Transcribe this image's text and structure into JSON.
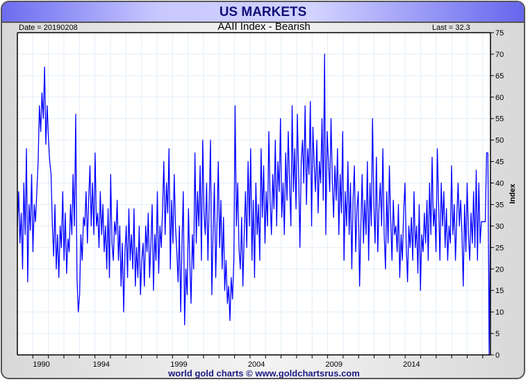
{
  "header": {
    "title": "US MARKETS"
  },
  "info": {
    "date": "Date = 20190208",
    "last": "Last = 32.3"
  },
  "footer": "world gold charts © www.goldchartsrus.com",
  "colors": {
    "line": "#0000ff",
    "grid": "#e2eef8"
  },
  "chart_data": {
    "type": "line",
    "title": "AAII Index - Bearish",
    "ylabel": "Index",
    "xlabel": "",
    "ylim": [
      0,
      75
    ],
    "xlim": [
      1988.6,
      2019.1
    ],
    "yticks": [
      0,
      5,
      10,
      15,
      20,
      25,
      30,
      35,
      40,
      45,
      50,
      55,
      60,
      65,
      70,
      75
    ],
    "xticks": [
      {
        "label": "1990",
        "year": 1989.6
      },
      {
        "label": "1994",
        "year": 1994
      },
      {
        "label": "1999",
        "year": 1999
      },
      {
        "label": "2004",
        "year": 2004
      },
      {
        "label": "2009",
        "year": 2009
      },
      {
        "label": "2014",
        "year": 2014
      }
    ],
    "grid": true,
    "series": [
      {
        "name": "AAII Bearish",
        "start": 1988.6,
        "end": 2019.1,
        "values": [
          30,
          38,
          26,
          33,
          20,
          40,
          28,
          48,
          17,
          35,
          29,
          42,
          24,
          35,
          31,
          38,
          45,
          58,
          52,
          61,
          55,
          67,
          49,
          58,
          50,
          45,
          42,
          30,
          23,
          35,
          20,
          28,
          18,
          30,
          25,
          38,
          22,
          33,
          19,
          27,
          24,
          35,
          28,
          42,
          30,
          56,
          18,
          10,
          14,
          28,
          22,
          32,
          30,
          38,
          26,
          36,
          44,
          30,
          40,
          28,
          47,
          30,
          33,
          25,
          38,
          28,
          35,
          24,
          30,
          20,
          34,
          18,
          42,
          26,
          22,
          31,
          28,
          36,
          22,
          30,
          16,
          26,
          10,
          24,
          30,
          18,
          34,
          22,
          28,
          20,
          34,
          16,
          25,
          18,
          30,
          14,
          22,
          26,
          16,
          30,
          24,
          33,
          18,
          26,
          35,
          15,
          28,
          22,
          38,
          19,
          30,
          25,
          34,
          45,
          28,
          40,
          33,
          48,
          20,
          36,
          26,
          42,
          30,
          24,
          17,
          30,
          10,
          26,
          38,
          7,
          20,
          14,
          34,
          22,
          12,
          28,
          20,
          47,
          26,
          38,
          30,
          44,
          22,
          50,
          33,
          28,
          40,
          22,
          35,
          50,
          14,
          28,
          40,
          18,
          30,
          45,
          25,
          36,
          20,
          32,
          15,
          22,
          12,
          16,
          8,
          18,
          13,
          22,
          58,
          30,
          40,
          25,
          20,
          32,
          16,
          28,
          38,
          25,
          45,
          30,
          48,
          22,
          36,
          18,
          40,
          28,
          35,
          22,
          48,
          32,
          44,
          26,
          38,
          30,
          52,
          36,
          28,
          42,
          34,
          50,
          30,
          45,
          38,
          55,
          32,
          40,
          28,
          47,
          36,
          52,
          40,
          30,
          58,
          38,
          48,
          34,
          56,
          42,
          25,
          45,
          50,
          40,
          58,
          35,
          48,
          42,
          59,
          30,
          53,
          44,
          38,
          50,
          33,
          45,
          40,
          55,
          36,
          70,
          28,
          52,
          45,
          38,
          55,
          40,
          32,
          44,
          36,
          48,
          28,
          42,
          33,
          52,
          22,
          38,
          30,
          45,
          28,
          40,
          20,
          36,
          44,
          24,
          34,
          38,
          16,
          30,
          42,
          26,
          36,
          28,
          45,
          22,
          40,
          30,
          55,
          35,
          26,
          46,
          24,
          34,
          40,
          30,
          48,
          28,
          20,
          38,
          26,
          44,
          32,
          22,
          36,
          28,
          30,
          24,
          35,
          18,
          28,
          22,
          33,
          40,
          26,
          17,
          30,
          25,
          32,
          22,
          38,
          25,
          30,
          19,
          35,
          15,
          28,
          24,
          33,
          26,
          36,
          22,
          40,
          28,
          46,
          30,
          34,
          24,
          48,
          35,
          22,
          40,
          30,
          38,
          25,
          34,
          22,
          30,
          26,
          44,
          28,
          35,
          22,
          32,
          40,
          30,
          36,
          28,
          16,
          35,
          24,
          40,
          28,
          22,
          33,
          26,
          38,
          25,
          43,
          22,
          40,
          26,
          31,
          31,
          31,
          31,
          47,
          47,
          0,
          32.3
        ]
      }
    ]
  }
}
